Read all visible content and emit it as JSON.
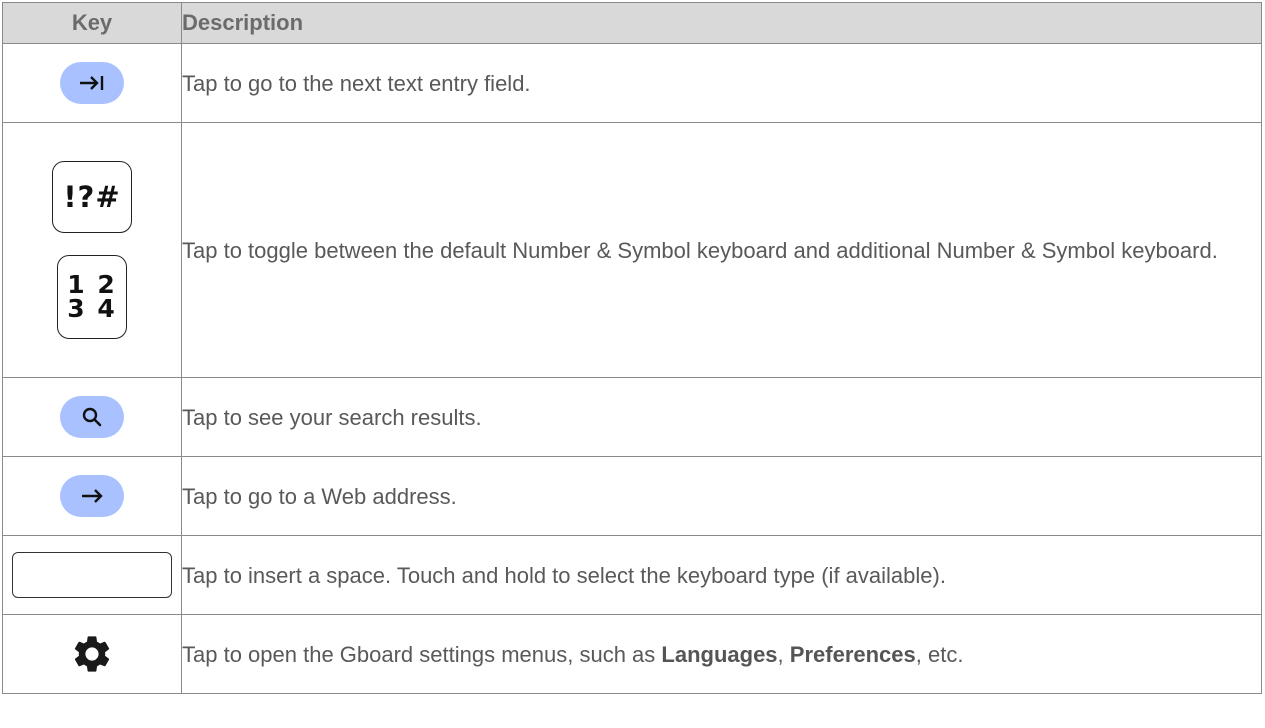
{
  "table": {
    "header": {
      "key": "Key",
      "description": "Description"
    },
    "rows": [
      {
        "icon": "tab-next-icon",
        "description": "Tap to go to the next text entry field."
      },
      {
        "icons": [
          "symbols-key-icon",
          "numbers-key-icon"
        ],
        "symbols_label": "!?#",
        "numbers_label_line1": "1 2",
        "numbers_label_line2": "3 4",
        "description": "Tap to toggle between the default Number & Symbol keyboard and additional Number & Symbol keyboard."
      },
      {
        "icon": "search-icon",
        "description": "Tap to see your search results."
      },
      {
        "icon": "go-arrow-icon",
        "description": "Tap to go to a Web address."
      },
      {
        "icon": "space-bar-icon",
        "description": "Tap to insert a space. Touch and hold to select the keyboard type (if available)."
      },
      {
        "icon": "gear-icon",
        "description_prefix": "Tap to open the Gboard settings menus, such as ",
        "bold_1": "Languages",
        "separator": ", ",
        "bold_2": "Preferences",
        "description_suffix": ", etc."
      }
    ]
  },
  "colors": {
    "header_bg": "#d9d9d9",
    "pill_accent": "#a9c2ff",
    "border": "#8a8a8a",
    "text": "#595959"
  }
}
